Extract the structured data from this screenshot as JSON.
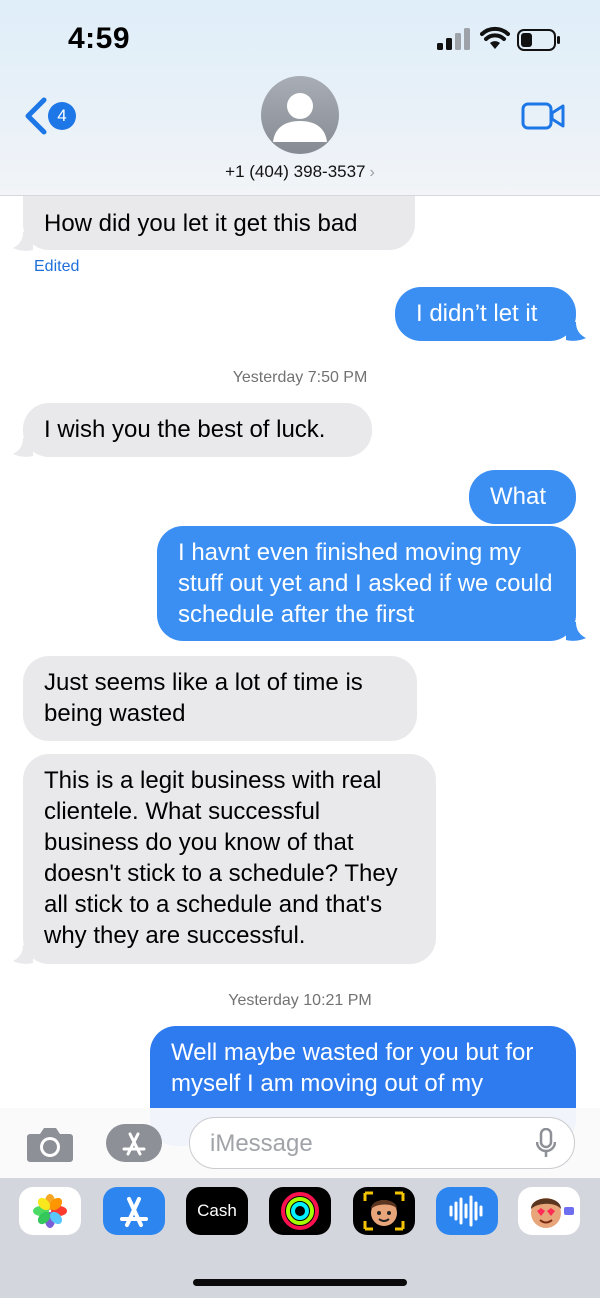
{
  "status_bar": {
    "time": "4:59"
  },
  "header": {
    "back_badge": "4",
    "contact": "+1 (404) 398-3537",
    "chevron": "›"
  },
  "messages": [
    {
      "dir": "in",
      "text": "How did you let it get this bad"
    },
    {
      "dir": "in",
      "note": "Edited"
    },
    {
      "dir": "out",
      "text": "I didn’t let it"
    },
    {
      "timestamp_day": "Yesterday",
      "timestamp_time": "7:50 PM"
    },
    {
      "dir": "in",
      "text": "I wish you the best of luck."
    },
    {
      "dir": "out",
      "text": "What"
    },
    {
      "dir": "out",
      "text": "I havnt even finished moving my stuff out yet and I asked if we could schedule after the first"
    },
    {
      "dir": "in",
      "text": "Just seems like a lot of time is being wasted"
    },
    {
      "dir": "in",
      "text": "This is a legit business with real clientele. What successful business do you know of that doesn't stick to a schedule? They all stick to a schedule and that's why they are successful."
    },
    {
      "timestamp_day": "Yesterday",
      "timestamp_time": "10:21 PM"
    },
    {
      "dir": "out",
      "text": "Well maybe wasted for you but for myself I am moving out of my"
    }
  ],
  "compose": {
    "placeholder": "iMessage"
  },
  "app_drawer": {
    "cash_label": "Cash",
    "apps": [
      "photos-icon",
      "app-store-icon",
      "apple-cash-icon",
      "activity-icon",
      "memoji-icon",
      "audio-message-icon",
      "memoji-stickers-icon"
    ]
  },
  "colors": {
    "incoming_bubble": "#e9e9eb",
    "outgoing_bubble": "#3b8ff3",
    "accent": "#1d77e6"
  }
}
